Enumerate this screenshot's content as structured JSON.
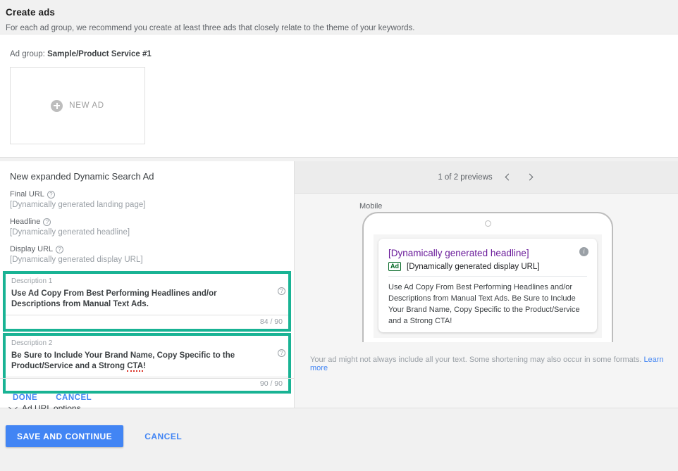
{
  "page": {
    "title": "Create ads",
    "subtitle": "For each ad group, we recommend you create at least three ads that closely relate to the theme of your keywords."
  },
  "ad_group": {
    "prefix": "Ad group:",
    "name": "Sample/Product Service #1",
    "new_ad_label": "NEW AD"
  },
  "editor": {
    "heading": "New expanded Dynamic Search Ad",
    "fields": [
      {
        "label": "Final URL",
        "value": "[Dynamically generated landing page]"
      },
      {
        "label": "Headline",
        "value": "[Dynamically generated headline]"
      },
      {
        "label": "Display URL",
        "value": "[Dynamically generated display URL]"
      }
    ],
    "descriptions": [
      {
        "label": "Description 1",
        "text_before": "Use Ad Copy From Best Performing Headlines and/or Descriptions from Manual Text Ads.",
        "counter": "84 / 90"
      },
      {
        "label": "Description 2",
        "text_before": "Be Sure to Include Your Brand Name, Copy Specific to the Product/Service and a Strong ",
        "misspelled": "CTA",
        "text_after": "!",
        "counter": "90 / 90"
      }
    ],
    "ad_url_options": "Ad URL options",
    "done_label": "DONE",
    "cancel_label": "CANCEL",
    "highlight_color": "#19b394"
  },
  "preview": {
    "counter": "1 of 2 previews",
    "prev_icon": "chevron-left-icon",
    "next_icon": "chevron-right-icon",
    "device_label": "Mobile",
    "ad": {
      "headline": "[Dynamically generated headline]",
      "badge": "Ad",
      "display_url": "[Dynamically generated display URL]",
      "description": "Use Ad Copy From Best Performing Headlines and/or Descriptions from Manual Text Ads. Be Sure to Include Your Brand Name, Copy Specific to the Product/Service and a Strong CTA!",
      "headline_color": "#6a1b9a",
      "badge_color": "#006621"
    },
    "note": "Your ad might not always include all your text. Some shortening may also occur in some formats.",
    "note_link": "Learn more"
  },
  "footer": {
    "save_label": "SAVE AND CONTINUE",
    "cancel_label": "CANCEL",
    "accent_color": "#4285f4"
  }
}
